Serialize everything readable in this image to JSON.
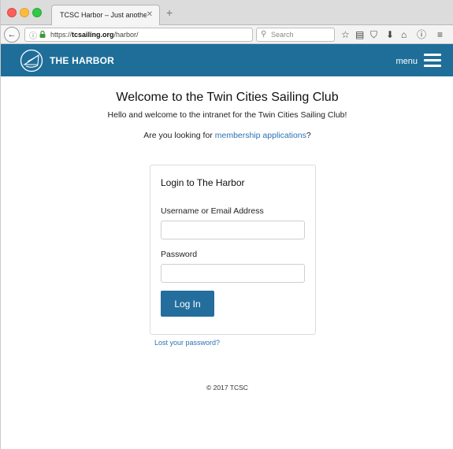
{
  "browser": {
    "tab_title": "TCSC Harbor – Just another TC...",
    "tab_close": "✕",
    "new_tab": "+",
    "url_prefix": "https://",
    "url_domain": "tcsailing.org",
    "url_path": "/harbor/",
    "search_placeholder": "Search",
    "back_glyph": "←",
    "reload_glyph": "C"
  },
  "header": {
    "title": "THE HARBOR",
    "menu_label": "menu",
    "brand_color": "#1f6e99"
  },
  "main": {
    "welcome_title": "Welcome to the Twin Cities Sailing Club",
    "welcome_sub": "Hello and welcome to the intranet for the Twin Cities Sailing Club!",
    "membership_prefix": "Are you looking for ",
    "membership_link": "membership applications",
    "membership_suffix": "?"
  },
  "login": {
    "title": "Login to The Harbor",
    "username_label": "Username or Email Address",
    "username_value": "",
    "password_label": "Password",
    "password_value": "",
    "button_label": "Log In",
    "lost_password": "Lost your password?"
  },
  "footer": {
    "text": "© 2017 TCSC"
  },
  "icons": [
    "info-icon",
    "lock-icon",
    "reload-icon",
    "search-icon",
    "star-icon",
    "reader-icon",
    "pocket-icon",
    "download-icon",
    "home-icon",
    "info-circle-icon",
    "hamburger-icon",
    "sailboat-logo"
  ]
}
